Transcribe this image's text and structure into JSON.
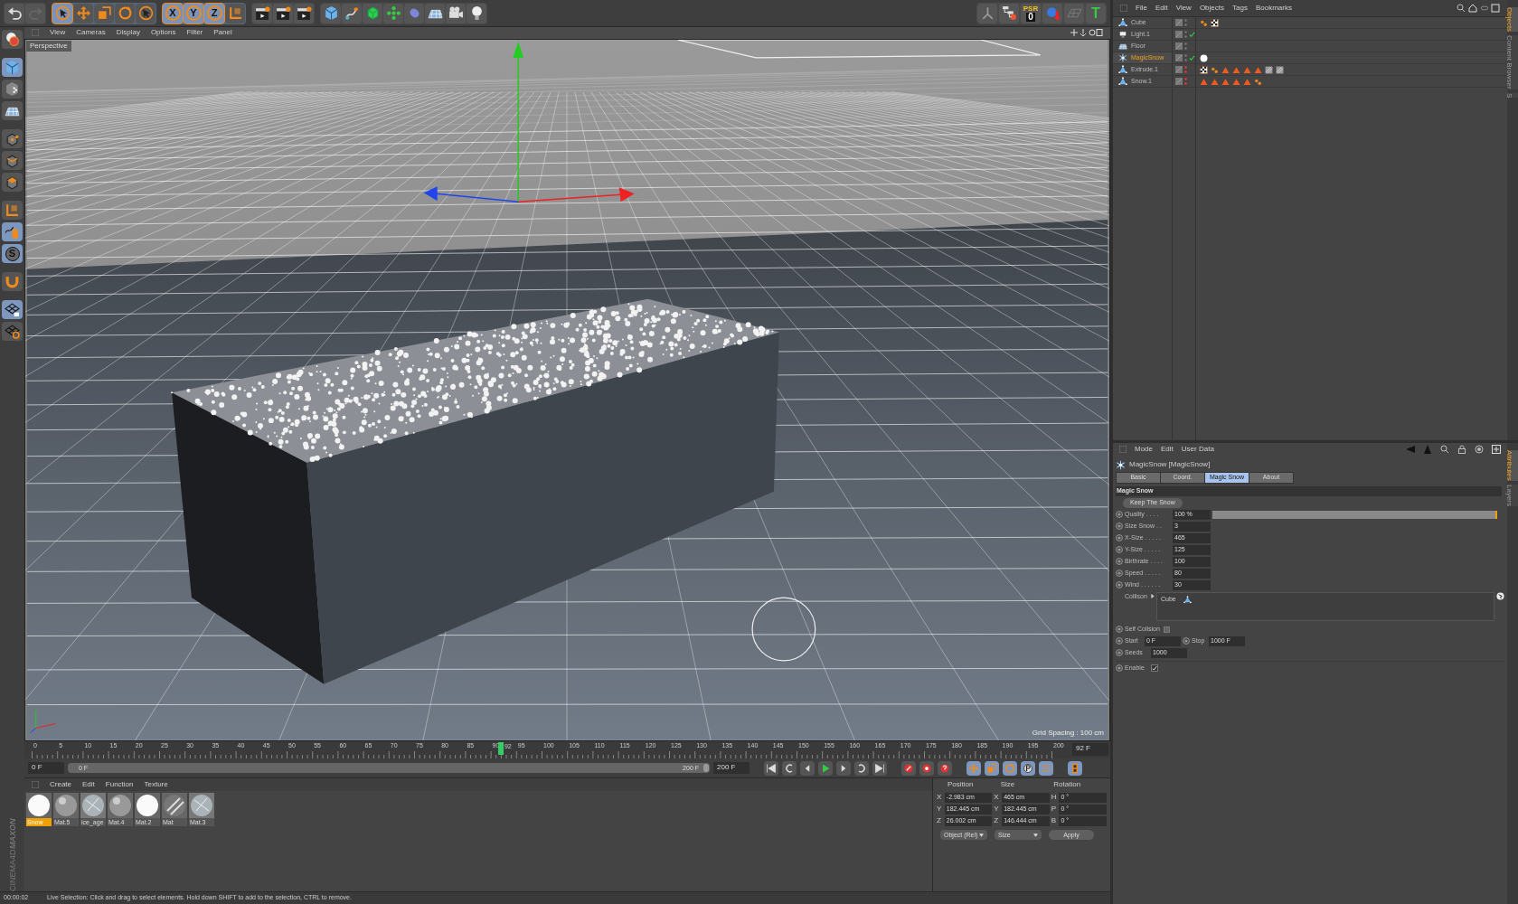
{
  "toolbar": {
    "groups": [
      {
        "tools": [
          {
            "kind": "undo",
            "selected": false
          },
          {
            "kind": "redo",
            "selected": false
          }
        ]
      },
      {
        "tools": [
          {
            "kind": "cursor",
            "selected": true
          },
          {
            "kind": "move",
            "selected": false
          },
          {
            "kind": "scale",
            "selected": false
          },
          {
            "kind": "rotate",
            "selected": false
          },
          {
            "kind": "cursor",
            "selected": false
          }
        ]
      },
      {
        "tools": [
          {
            "kind": "axis",
            "label": "X",
            "selected": true
          },
          {
            "kind": "axis",
            "label": "Y",
            "selected": true
          },
          {
            "kind": "axis",
            "label": "Z",
            "selected": true
          },
          {
            "kind": "coords",
            "selected": false
          }
        ]
      },
      {
        "tools": [
          {
            "kind": "clapper",
            "selected": false
          },
          {
            "kind": "clapper",
            "selected": false
          },
          {
            "kind": "clapper",
            "selected": false
          }
        ]
      },
      {
        "tools": [
          {
            "kind": "cube",
            "selected": false
          },
          {
            "kind": "pen",
            "selected": false
          },
          {
            "kind": "meshcube",
            "selected": false
          },
          {
            "kind": "flower",
            "selected": false
          },
          {
            "kind": "capsule",
            "selected": false
          },
          {
            "kind": "floor",
            "selected": false
          },
          {
            "kind": "camera",
            "selected": false
          },
          {
            "kind": "bulb",
            "selected": false
          }
        ]
      }
    ],
    "right_tools": [
      {
        "kind": "joint"
      },
      {
        "kind": "hierarchy"
      },
      {
        "kind": "psr",
        "label": "PSR",
        "value": "0"
      },
      {
        "kind": "sphere"
      },
      {
        "kind": "grid"
      },
      {
        "kind": "text",
        "label": "T"
      }
    ]
  },
  "left_toolbar": [
    {
      "kind": "ball",
      "selected": false
    },
    {
      "kind": "cube",
      "selected": true
    },
    {
      "kind": "checkercube",
      "selected": false
    },
    {
      "kind": "floor",
      "selected": false
    },
    {
      "kind": "points",
      "selected": false
    },
    {
      "kind": "edges",
      "selected": false
    },
    {
      "kind": "faces",
      "selected": false
    },
    {
      "kind": "coords",
      "selected": false
    },
    {
      "kind": "mouse",
      "selected": true
    },
    {
      "kind": "snap",
      "label": "S",
      "selected": true
    },
    {
      "kind": "magnet",
      "selected": false
    },
    {
      "kind": "gridlock",
      "selected": true
    },
    {
      "kind": "gridrotate",
      "selected": false
    }
  ],
  "viewport": {
    "menu": [
      "View",
      "Cameras",
      "Display",
      "Options",
      "Filter",
      "Panel"
    ],
    "camera": "Perspective",
    "grid_spacing": "Grid Spacing : 100 cm"
  },
  "timeline": {
    "ticks": [
      "0",
      "5",
      "10",
      "15",
      "20",
      "25",
      "30",
      "35",
      "40",
      "45",
      "50",
      "55",
      "60",
      "65",
      "70",
      "75",
      "80",
      "85",
      "90",
      "95",
      "100",
      "105",
      "110",
      "115",
      "120",
      "125",
      "130",
      "135",
      "140",
      "145",
      "150",
      "155",
      "160",
      "165",
      "170",
      "175",
      "180",
      "185",
      "190",
      "195",
      "200"
    ],
    "current": "92",
    "current_field": "92 F",
    "start_field": "0 F",
    "range": {
      "start": "0 F",
      "end": "200 F",
      "level": 1
    },
    "end_field": "200 F"
  },
  "materials": {
    "menu": [
      "Create",
      "Edit",
      "Function",
      "Texture"
    ],
    "items": [
      {
        "name": "Snow",
        "kind": "white",
        "selected": true
      },
      {
        "name": "Mat.5",
        "kind": "gray",
        "selected": false
      },
      {
        "name": "ice_age",
        "kind": "ice",
        "selected": false
      },
      {
        "name": "Mat.4",
        "kind": "gray",
        "selected": false
      },
      {
        "name": "Mat.2",
        "kind": "white",
        "selected": false
      },
      {
        "name": "Mat",
        "kind": "stripe",
        "selected": false
      },
      {
        "name": "Mat.3",
        "kind": "ice",
        "selected": false
      }
    ]
  },
  "coordinates": {
    "headers": [
      "Position",
      "Size",
      "Rotation"
    ],
    "rows": [
      {
        "pos_axis": "X",
        "position": "-2.983 cm",
        "size_axis": "X",
        "size": "465 cm",
        "rot_axis": "H",
        "rotation": "0 °"
      },
      {
        "pos_axis": "Y",
        "position": "182.445 cm",
        "size_axis": "Y",
        "size": "182.445 cm",
        "rot_axis": "P",
        "rotation": "0 °"
      },
      {
        "pos_axis": "Z",
        "position": "26.002 cm",
        "size_axis": "Z",
        "size": "146.444 cm",
        "rot_axis": "B",
        "rotation": "0 °"
      }
    ],
    "mode": "Object (Rel)",
    "size_mode": "Size",
    "apply": "Apply"
  },
  "logo": [
    "MAXON",
    "CINEMA4D"
  ],
  "status_bar": {
    "time": "00:00:02",
    "message": "Live Selection: Click and drag to select elements. Hold down SHIFT to add to the selection, CTRL to remove."
  },
  "object_manager": {
    "menu": [
      "File",
      "Edit",
      "View",
      "Objects",
      "Tags",
      "Bookmarks"
    ],
    "objects": [
      {
        "name": "Cube",
        "kind": "polygon",
        "selected": false,
        "checked": false,
        "hidden": false,
        "tags": [
          {
            "kind": "dots"
          },
          {
            "kind": "checker"
          }
        ]
      },
      {
        "name": "Light.1",
        "kind": "light",
        "selected": false,
        "checked": true,
        "hidden": false
      },
      {
        "name": "Floor",
        "kind": "floor",
        "selected": false,
        "checked": false,
        "hidden": false
      },
      {
        "name": "MagicSnow",
        "kind": "snow",
        "selected": true,
        "checked": true,
        "hidden": false,
        "tags": [
          {
            "kind": "ball"
          }
        ]
      },
      {
        "name": "Extrude.1",
        "kind": "polygon",
        "selected": false,
        "checked": false,
        "hidden": true,
        "tags": [
          {
            "kind": "checker"
          },
          {
            "kind": "dots"
          },
          {
            "kind": "triangle"
          },
          {
            "kind": "triangle"
          },
          {
            "kind": "triangle"
          },
          {
            "kind": "triangle"
          },
          {
            "kind": "texture"
          },
          {
            "kind": "texture"
          }
        ]
      },
      {
        "name": "Snow.1",
        "kind": "polygon",
        "selected": false,
        "checked": false,
        "hidden": true,
        "tags": [
          {
            "kind": "triangle"
          },
          {
            "kind": "triangle"
          },
          {
            "kind": "triangle"
          },
          {
            "kind": "triangle"
          },
          {
            "kind": "triangle"
          },
          {
            "kind": "dots"
          }
        ]
      }
    ]
  },
  "side_tabs_top": [
    {
      "label": "Objects",
      "selected": true
    },
    {
      "label": "Content Browser",
      "selected": false
    },
    {
      "label": "S",
      "selected": false
    }
  ],
  "side_tabs_bottom": [
    {
      "label": "Attributes",
      "selected": true
    },
    {
      "label": "Layers",
      "selected": false
    }
  ],
  "attributes": {
    "menu": [
      "Mode",
      "Edit",
      "User Data"
    ],
    "title": "MagicSnow [MagicSnow]",
    "tabs": [
      {
        "label": "Basic",
        "selected": false
      },
      {
        "label": "Coord.",
        "selected": false
      },
      {
        "label": "Magic Snow",
        "selected": true
      },
      {
        "label": "About",
        "selected": false
      }
    ],
    "section": "Magic Snow",
    "button": "Keep The Snow",
    "params": [
      {
        "kind": "slider",
        "label": "Quality . . . .",
        "value": "100 %",
        "level": 1
      },
      {
        "kind": "number",
        "label": "Size Snow . .",
        "value": "3"
      },
      {
        "kind": "number",
        "label": "X-Size . . . . .",
        "value": "465"
      },
      {
        "kind": "number",
        "label": "Y-Size . . . . .",
        "value": "125"
      },
      {
        "kind": "number",
        "label": "Birthrate . . . .",
        "value": "100"
      },
      {
        "kind": "number",
        "label": "Speed . . . . .",
        "value": "80"
      },
      {
        "kind": "number",
        "label": "Wind . . . . . .",
        "value": "30"
      }
    ],
    "collision": {
      "label": "Collison",
      "items": [
        "Cube"
      ]
    },
    "self_collision": {
      "label": "Self Colision",
      "checked": false
    },
    "start": {
      "label": "Start",
      "value": "0 F"
    },
    "stop": {
      "label": "Stop",
      "value": "1000 F"
    },
    "seeds": {
      "label": "Seeds",
      "value": "1000"
    },
    "enable": {
      "label": "Enable",
      "checked": true
    }
  }
}
